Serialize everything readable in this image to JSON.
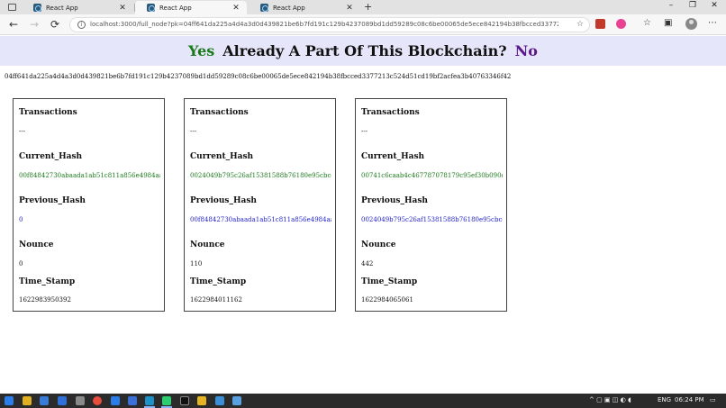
{
  "browser": {
    "tabs": [
      {
        "title": "React App",
        "active": false
      },
      {
        "title": "React App",
        "active": true
      },
      {
        "title": "React App",
        "active": false
      }
    ],
    "new_tab_symbol": "+",
    "window_controls": {
      "minimize": "–",
      "restore": "❐",
      "close": "✕"
    },
    "nav": {
      "back": "←",
      "forward": "→",
      "reload": "⟳"
    },
    "url": "localhost:3000/full_node?pk=04ff641da225a4d4a3d0d439821be6b7fd191c129b4237089bd1dd59289c08c6be00065de5ece842194b38fbcced3377213c524d51cd19...",
    "icons": [
      "info-icon",
      "star-icon",
      "collections-icon",
      "settings-icon",
      "profile-icon"
    ]
  },
  "banner": {
    "yes": "Yes",
    "question": "Already A Part Of This Blockchain?",
    "no": "No"
  },
  "node_key": "04ff641da225a4d4a3d0d439821be6b7fd191c129b4237089bd1dd59289c08c6be00065de5ece842194b38fbcced3377213c524d51cd19bf2acfea3b40763346f42",
  "labels": {
    "transactions": "Transactions",
    "current_hash": "Current_Hash",
    "previous_hash": "Previous_Hash",
    "nounce": "Nounce",
    "time_stamp": "Time_Stamp"
  },
  "blocks": [
    {
      "transactions": "---",
      "current_hash": "00f84842730abaada1ab51c811a856e4984aaba",
      "previous_hash": "0",
      "nounce": "0",
      "time_stamp": "1622983950392"
    },
    {
      "transactions": "---",
      "current_hash": "0024049b795c26af15381588b76180e95cbcd4",
      "previous_hash": "00f84842730abaada1ab51c811a856e4984aaba",
      "nounce": "110",
      "time_stamp": "1622984011162"
    },
    {
      "transactions": "---",
      "current_hash": "00741c6caab4c467787078179c95ef30b090cf9",
      "previous_hash": "0024049b795c26af15381588b76180e95cbcd4",
      "nounce": "442",
      "time_stamp": "1622984065061"
    }
  ],
  "taskbar": {
    "language": "ENG",
    "time": "06:24 PM"
  },
  "colors": {
    "yes": "#1a7a1a",
    "no": "#5a1a8a",
    "banner_bg": "#e6e6fa",
    "current_hash": "#1a7a1a",
    "previous_hash": "#2222cc"
  }
}
